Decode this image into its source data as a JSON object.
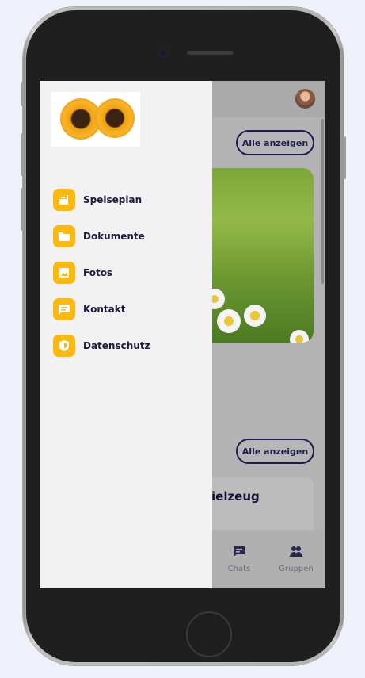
{
  "home": {
    "header_avatar": "user-avatar",
    "section1_button": "Alle anzeigen",
    "section2_button": "Alle anzeigen",
    "card2_title_fragment": "ielzeug"
  },
  "bottom_nav": {
    "items": [
      {
        "label": "Chats",
        "icon": "chat-icon"
      },
      {
        "label": "Gruppen",
        "icon": "group-icon"
      }
    ]
  },
  "drawer": {
    "logo": "sunflowers-logo",
    "items": [
      {
        "label": "Speiseplan",
        "icon": "food-icon"
      },
      {
        "label": "Dokumente",
        "icon": "folder-icon"
      },
      {
        "label": "Fotos",
        "icon": "photo-icon"
      },
      {
        "label": "Kontakt",
        "icon": "message-icon"
      },
      {
        "label": "Datenschutz",
        "icon": "shield-icon"
      }
    ]
  },
  "colors": {
    "accent": "#fbb90f",
    "text_dark": "#1b1b42",
    "drawer_bg": "#f2f2f2",
    "overlay": "#b3b3b3"
  }
}
